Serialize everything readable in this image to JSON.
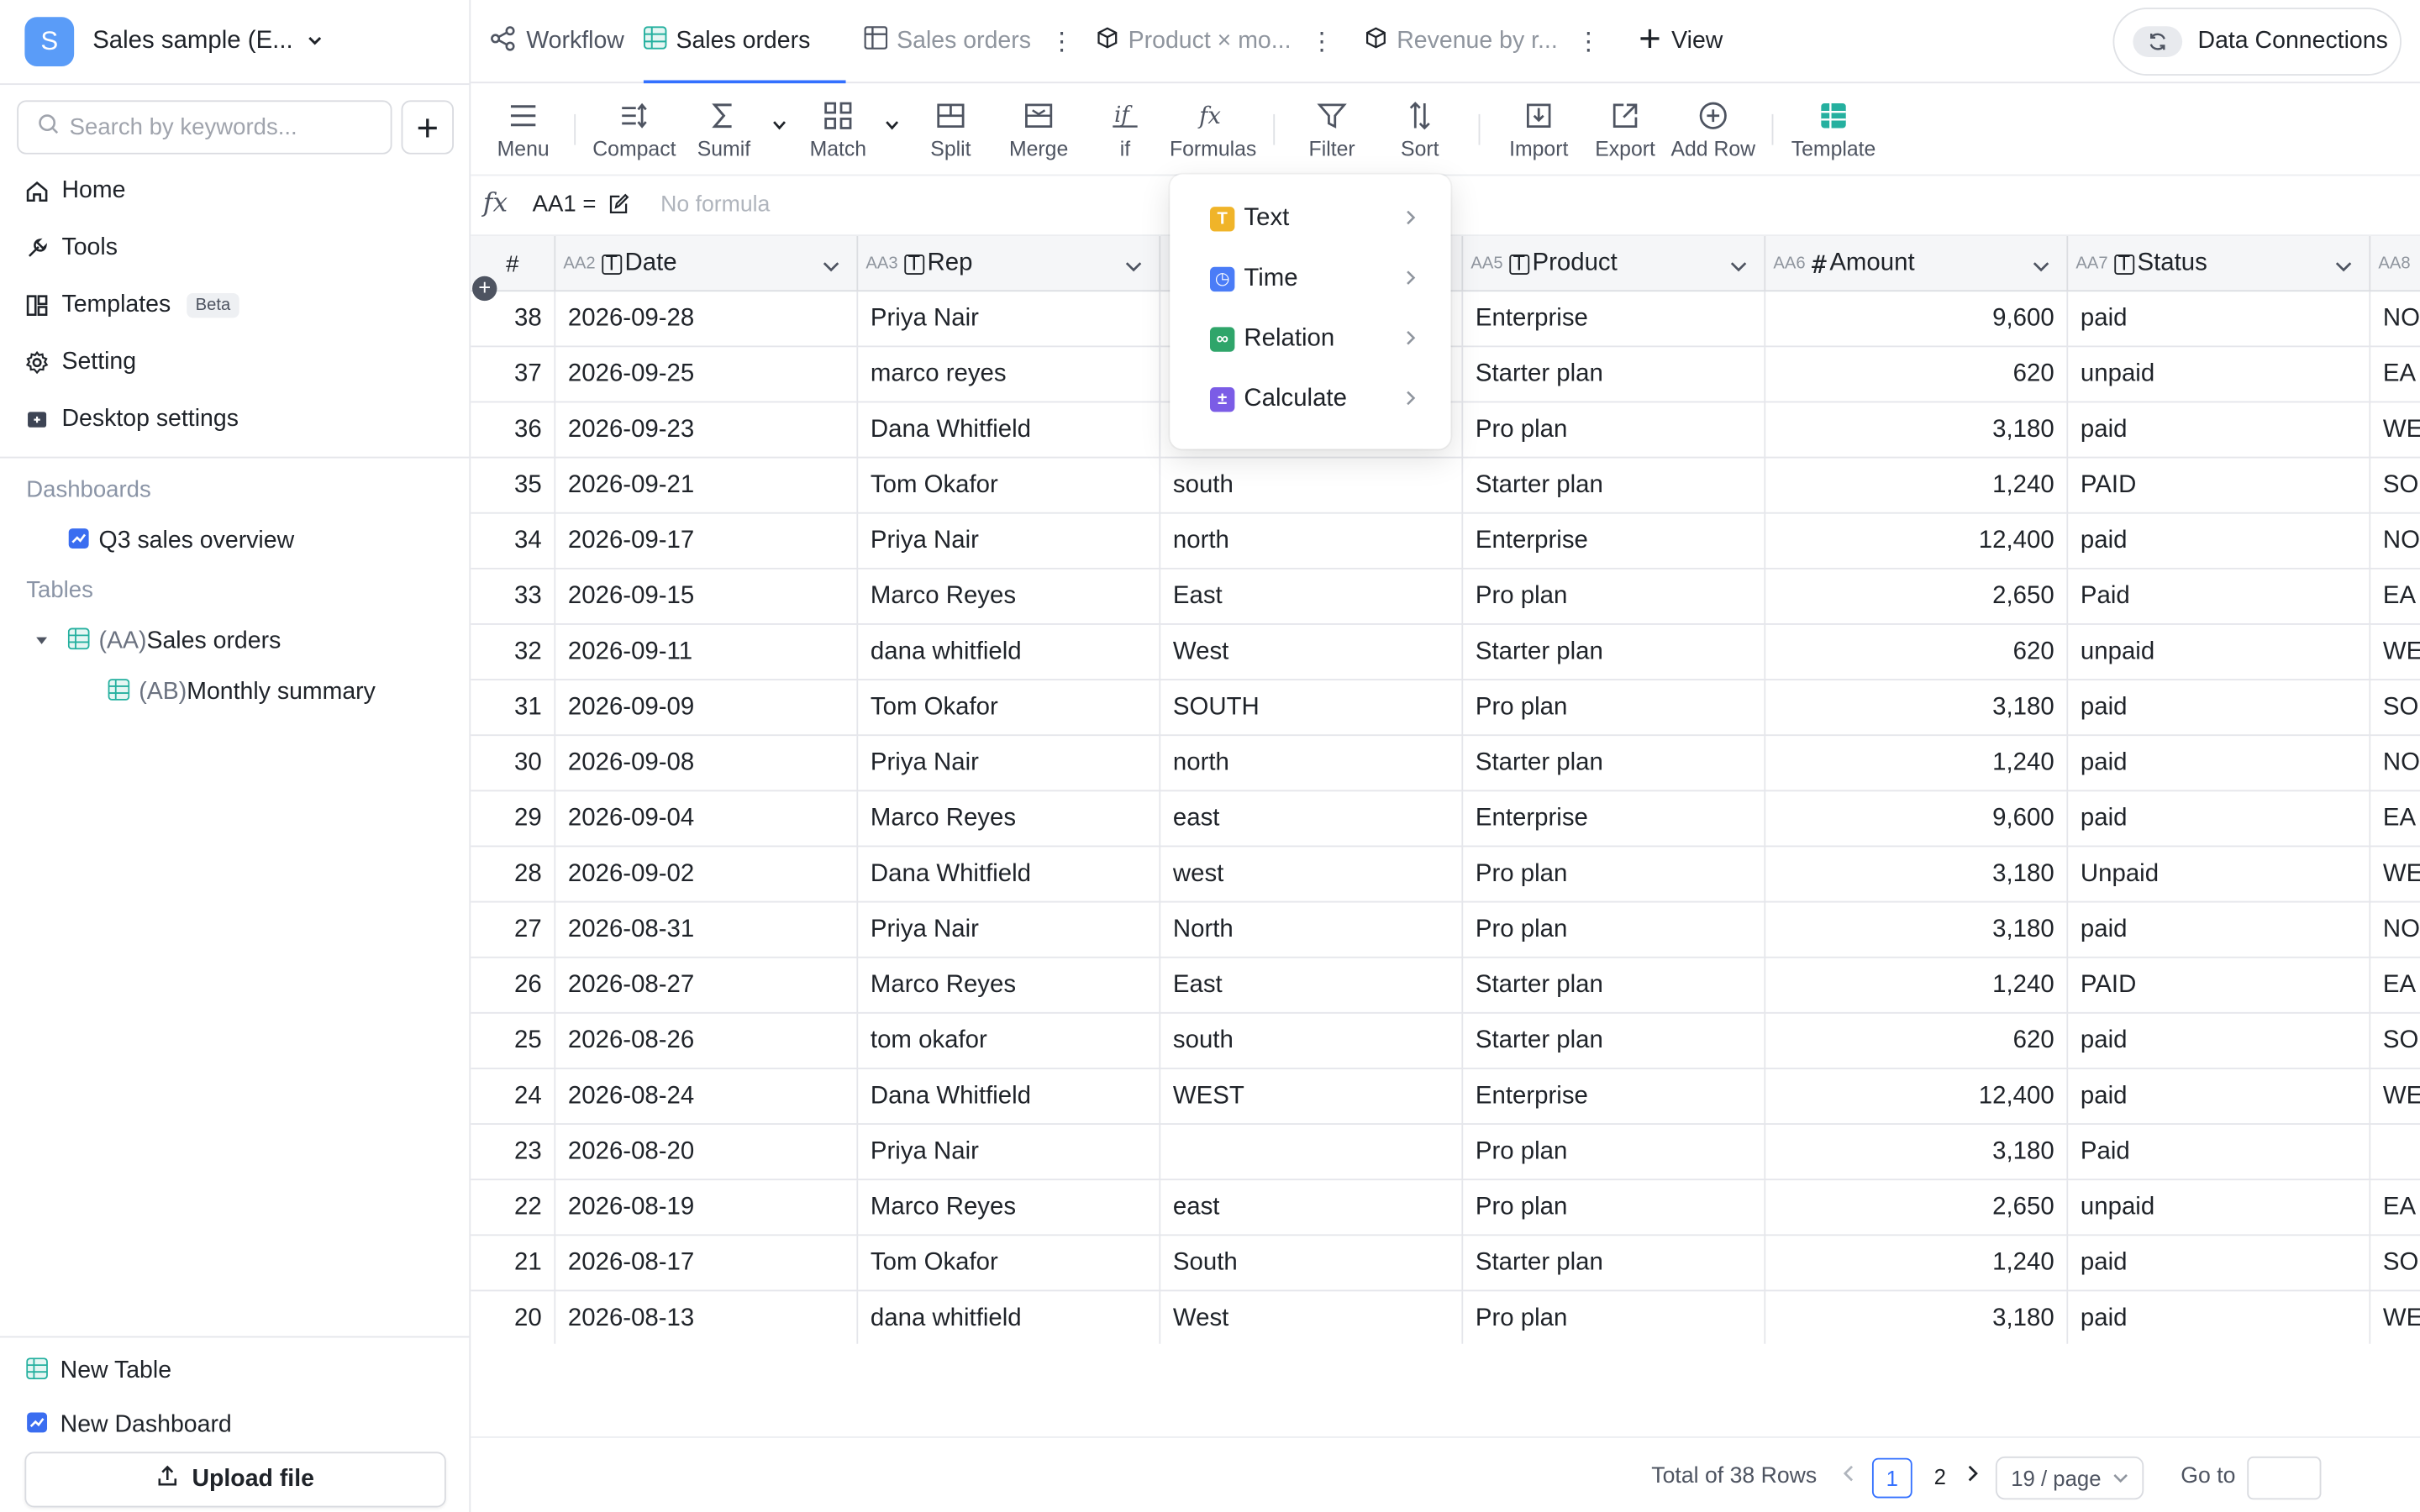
{
  "workspace": {
    "avatar_letter": "S",
    "name": "Sales sample (E..."
  },
  "sidebar": {
    "search_placeholder": "Search by keywords...",
    "nav": [
      {
        "label": "Home",
        "icon": "home-icon"
      },
      {
        "label": "Tools",
        "icon": "wrench-icon"
      },
      {
        "label": "Templates",
        "icon": "templates-icon",
        "badge": "Beta"
      },
      {
        "label": "Setting",
        "icon": "gear-icon"
      },
      {
        "label": "Desktop settings",
        "icon": "desktop-icon"
      }
    ],
    "dashboards_label": "Dashboards",
    "dashboards": [
      {
        "label": "Q3 sales overview"
      }
    ],
    "tables_label": "Tables",
    "tables": [
      {
        "prefix": "(AA)",
        "label": "Sales orders"
      },
      {
        "prefix": "(AB)",
        "label": "Monthly summary"
      }
    ],
    "new_table": "New Table",
    "new_dashboard": "New Dashboard",
    "upload": "Upload file"
  },
  "tabs": {
    "workflow": "Workflow",
    "sales_orders_active": "Sales orders",
    "sales_orders_2": "Sales orders",
    "product": "Product × mo...",
    "revenue": "Revenue by r...",
    "add_view": "View",
    "data_connections": "Data Connections"
  },
  "toolbar": {
    "menu": "Menu",
    "compact": "Compact",
    "sumif": "Sumif",
    "match": "Match",
    "split": "Split",
    "merge": "Merge",
    "if": "if",
    "formulas": "Formulas",
    "filter": "Filter",
    "sort": "Sort",
    "import": "Import",
    "export": "Export",
    "add_row": "Add Row",
    "template": "Template"
  },
  "formula_bar": {
    "cell_ref": "AA1 =",
    "placeholder": "No formula"
  },
  "grid": {
    "index_header": "#",
    "columns": [
      {
        "code": "AA2",
        "type": "T",
        "title": "Date"
      },
      {
        "code": "AA3",
        "type": "T",
        "title": "Rep"
      },
      {
        "code": "",
        "type": "",
        "title": ""
      },
      {
        "code": "AA5",
        "type": "T",
        "title": "Product"
      },
      {
        "code": "AA6",
        "type": "#",
        "title": "Amount"
      },
      {
        "code": "AA7",
        "type": "T",
        "title": "Status"
      },
      {
        "code": "AA8",
        "type": "",
        "title": ""
      }
    ],
    "rows": [
      {
        "id": "38",
        "date": "2026-09-28",
        "rep": "Priya Nair",
        "region": "",
        "product": "Enterprise",
        "amount": "9,600",
        "status": "paid",
        "extra": "NO"
      },
      {
        "id": "37",
        "date": "2026-09-25",
        "rep": "marco reyes",
        "region": "",
        "product": "Starter plan",
        "amount": "620",
        "status": "unpaid",
        "extra": "EA"
      },
      {
        "id": "36",
        "date": "2026-09-23",
        "rep": "Dana Whitfield",
        "region": "",
        "product": "Pro plan",
        "amount": "3,180",
        "status": "paid",
        "extra": "WE"
      },
      {
        "id": "35",
        "date": "2026-09-21",
        "rep": "Tom Okafor",
        "region": "south",
        "product": "Starter plan",
        "amount": "1,240",
        "status": "PAID",
        "extra": "SO"
      },
      {
        "id": "34",
        "date": "2026-09-17",
        "rep": "Priya Nair",
        "region": "north",
        "product": "Enterprise",
        "amount": "12,400",
        "status": "paid",
        "extra": "NO"
      },
      {
        "id": "33",
        "date": "2026-09-15",
        "rep": "Marco Reyes",
        "region": "East",
        "product": "Pro plan",
        "amount": "2,650",
        "status": "Paid",
        "extra": "EA"
      },
      {
        "id": "32",
        "date": "2026-09-11",
        "rep": "dana whitfield",
        "region": "West",
        "product": "Starter plan",
        "amount": "620",
        "status": "unpaid",
        "extra": "WE"
      },
      {
        "id": "31",
        "date": "2026-09-09",
        "rep": "Tom Okafor",
        "region": "SOUTH",
        "product": "Pro plan",
        "amount": "3,180",
        "status": "paid",
        "extra": "SO"
      },
      {
        "id": "30",
        "date": "2026-09-08",
        "rep": "Priya Nair",
        "region": "north",
        "product": "Starter plan",
        "amount": "1,240",
        "status": "paid",
        "extra": "NO"
      },
      {
        "id": "29",
        "date": "2026-09-04",
        "rep": "Marco Reyes",
        "region": "east",
        "product": "Enterprise",
        "amount": "9,600",
        "status": "paid",
        "extra": "EA"
      },
      {
        "id": "28",
        "date": "2026-09-02",
        "rep": "Dana Whitfield",
        "region": "west",
        "product": "Pro plan",
        "amount": "3,180",
        "status": "Unpaid",
        "extra": "WE"
      },
      {
        "id": "27",
        "date": "2026-08-31",
        "rep": "Priya Nair",
        "region": "North",
        "product": "Pro plan",
        "amount": "3,180",
        "status": "paid",
        "extra": "NO"
      },
      {
        "id": "26",
        "date": "2026-08-27",
        "rep": "Marco Reyes",
        "region": "East",
        "product": "Starter plan",
        "amount": "1,240",
        "status": "PAID",
        "extra": "EA"
      },
      {
        "id": "25",
        "date": "2026-08-26",
        "rep": "tom okafor",
        "region": "south",
        "product": "Starter plan",
        "amount": "620",
        "status": "paid",
        "extra": "SO"
      },
      {
        "id": "24",
        "date": "2026-08-24",
        "rep": "Dana Whitfield",
        "region": "WEST",
        "product": "Enterprise",
        "amount": "12,400",
        "status": "paid",
        "extra": "WE"
      },
      {
        "id": "23",
        "date": "2026-08-20",
        "rep": "Priya Nair",
        "region": "",
        "product": "Pro plan",
        "amount": "3,180",
        "status": "Paid",
        "extra": ""
      },
      {
        "id": "22",
        "date": "2026-08-19",
        "rep": "Marco Reyes",
        "region": "east",
        "product": "Pro plan",
        "amount": "2,650",
        "status": "unpaid",
        "extra": "EA"
      },
      {
        "id": "21",
        "date": "2026-08-17",
        "rep": "Tom Okafor",
        "region": "South",
        "product": "Starter plan",
        "amount": "1,240",
        "status": "paid",
        "extra": "SO"
      },
      {
        "id": "20",
        "date": "2026-08-13",
        "rep": "dana whitfield",
        "region": "West",
        "product": "Pro plan",
        "amount": "3,180",
        "status": "paid",
        "extra": "WE"
      }
    ]
  },
  "pagination": {
    "total": "Total of 38 Rows",
    "page1": "1",
    "page2": "2",
    "page_size": "19 / page",
    "goto": "Go to"
  },
  "formulas_menu": [
    {
      "label": "Text",
      "icon": "text-type-icon",
      "glyph": "T",
      "color": "#f0b429"
    },
    {
      "label": "Time",
      "icon": "clock-icon",
      "glyph": "◷",
      "color": "#4a7cf7"
    },
    {
      "label": "Relation",
      "icon": "relation-icon",
      "glyph": "∞",
      "color": "#2fa56a"
    },
    {
      "label": "Calculate",
      "icon": "calculate-icon",
      "glyph": "±",
      "color": "#7b5ce6"
    }
  ],
  "colors": {
    "accent": "#3370ff",
    "avatar": "#5a9cf8",
    "table_icon": "#25b09f",
    "dashboard_icon": "#3a6df0"
  }
}
